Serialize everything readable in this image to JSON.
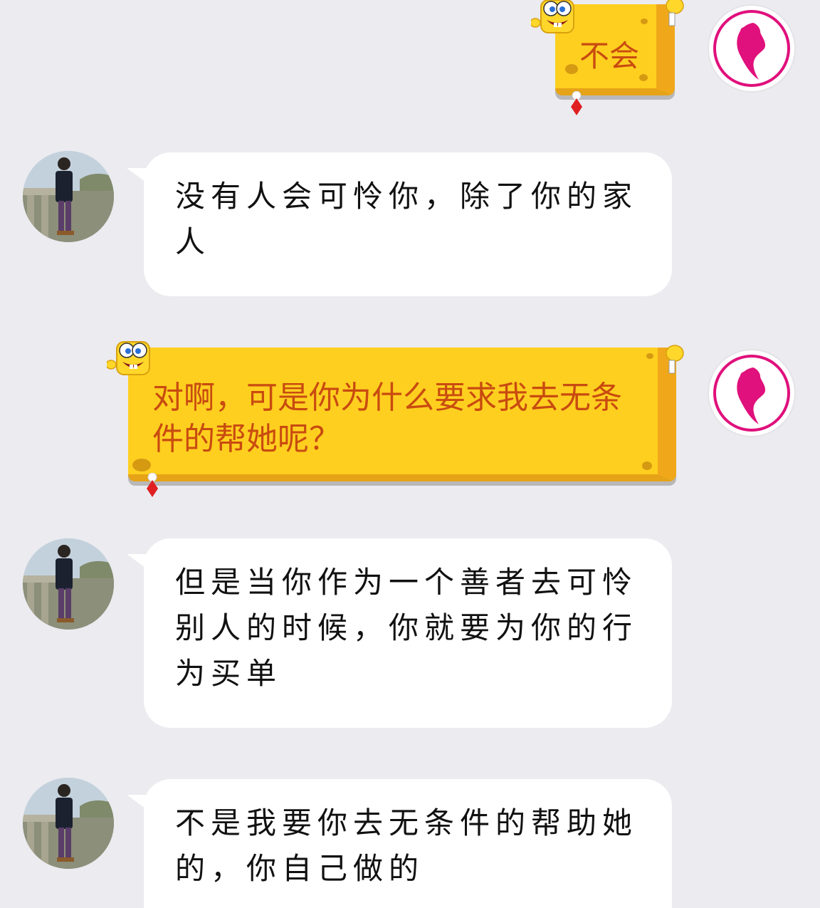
{
  "colors": {
    "background": "#ebebf0",
    "bubble_white": "#ffffff",
    "bubble_yellow": "#ffcf1f",
    "yellow_text": "#c84b10",
    "logo_pink": "#e0107c"
  },
  "messages": [
    {
      "side": "right",
      "style": "spongebob-yellow",
      "avatar": "pink-logo-avatar",
      "text": "不会"
    },
    {
      "side": "left",
      "style": "white",
      "avatar": "photo-avatar",
      "text": "没有人会可怜你，除了你的家人"
    },
    {
      "side": "right",
      "style": "spongebob-yellow",
      "avatar": "pink-logo-avatar",
      "text": "对啊，可是你为什么要求我去无条件的帮她呢？"
    },
    {
      "side": "left",
      "style": "white",
      "avatar": "photo-avatar",
      "text": "但是当你作为一个善者去可怜别人的时候，你就要为你的行为买单"
    },
    {
      "side": "left",
      "style": "white",
      "avatar": "photo-avatar",
      "text": "不是我要你去无条件的帮助她的，你自己做的"
    }
  ]
}
